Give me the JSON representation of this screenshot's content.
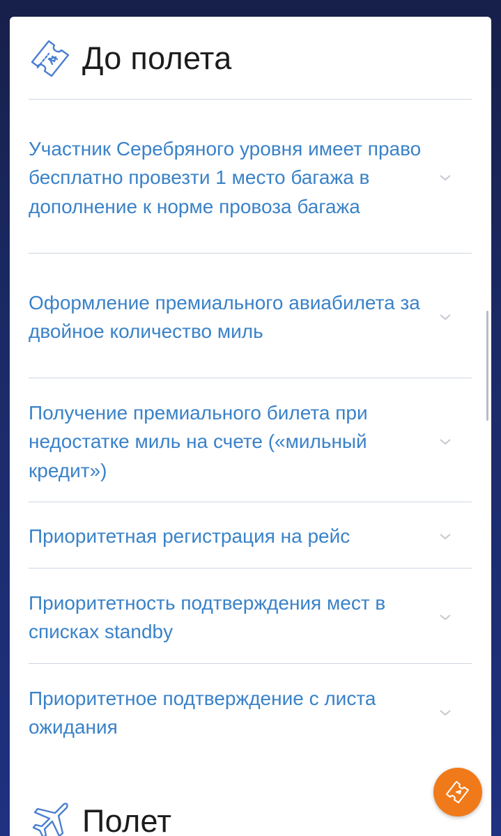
{
  "sections": {
    "before_flight": {
      "title": "До полета",
      "icon": "ticket-icon"
    },
    "flight": {
      "title": "Полет",
      "icon": "airplane-icon"
    }
  },
  "items": [
    {
      "label": "Участник Серебряного уровня имеет право бесплатно провезти 1 место багажа в дополнение к норме провоза багажа"
    },
    {
      "label": "Оформление премиального авиабилета за двойное количество миль"
    },
    {
      "label": "Получение премиального билета при недостатке миль на счете («мильный кредит»)"
    },
    {
      "label": "Приоритетная регистрация на рейс"
    },
    {
      "label": "Приоритетность подтверждения мест в списках standby"
    },
    {
      "label": "Приоритетное подтверждение с листа ожидания"
    }
  ],
  "colors": {
    "link": "#3a82c8",
    "fab": "#f07a1a",
    "accent": "#4a7fd0"
  },
  "fab": {
    "icon": "ticket-icon"
  }
}
